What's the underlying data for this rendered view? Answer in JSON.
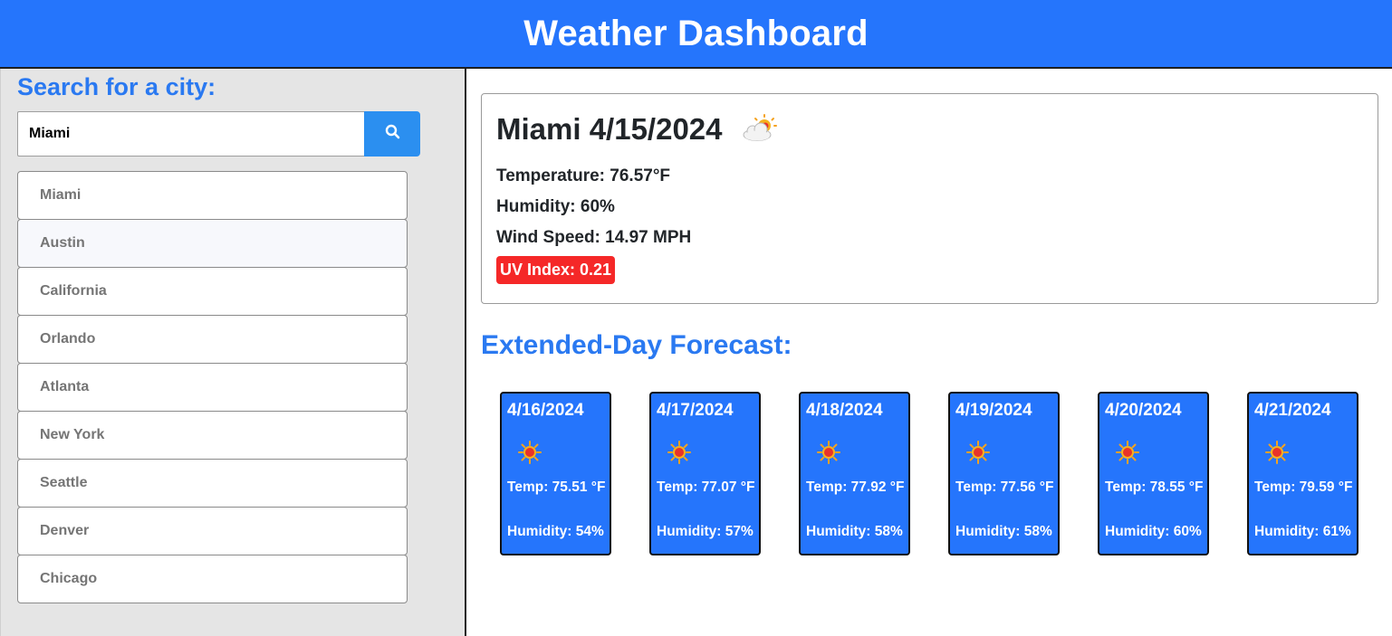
{
  "header": {
    "title": "Weather Dashboard"
  },
  "sidebar": {
    "heading": "Search for a city:",
    "search": {
      "value": "Miami",
      "placeholder": ""
    },
    "search_button_icon": "search-icon",
    "history": [
      {
        "label": "Miami"
      },
      {
        "label": "Austin"
      },
      {
        "label": "California"
      },
      {
        "label": "Orlando"
      },
      {
        "label": "Atlanta"
      },
      {
        "label": "New York"
      },
      {
        "label": "Seattle"
      },
      {
        "label": "Denver"
      },
      {
        "label": "Chicago"
      }
    ]
  },
  "current": {
    "title": "Miami 4/15/2024",
    "icon": "partly-cloudy-icon",
    "temperature": "Temperature: 76.57°F",
    "humidity": "Humidity: 60%",
    "wind": "Wind Speed: 14.97 MPH",
    "uv": "UV Index: 0.21",
    "uv_color": "#f52828"
  },
  "forecast": {
    "heading": "Extended-Day Forecast:",
    "days": [
      {
        "date": "4/16/2024",
        "icon": "sun-icon",
        "temp": "Temp: 75.51 °F",
        "humidity": "Humidity: 54%"
      },
      {
        "date": "4/17/2024",
        "icon": "sun-icon",
        "temp": "Temp: 77.07 °F",
        "humidity": "Humidity: 57%"
      },
      {
        "date": "4/18/2024",
        "icon": "sun-icon",
        "temp": "Temp: 77.92 °F",
        "humidity": "Humidity: 58%"
      },
      {
        "date": "4/19/2024",
        "icon": "sun-icon",
        "temp": "Temp: 77.56 °F",
        "humidity": "Humidity: 58%"
      },
      {
        "date": "4/20/2024",
        "icon": "sun-icon",
        "temp": "Temp: 78.55 °F",
        "humidity": "Humidity: 60%"
      },
      {
        "date": "4/21/2024",
        "icon": "sun-icon",
        "temp": "Temp: 79.59 °F",
        "humidity": "Humidity: 61%"
      }
    ]
  },
  "colors": {
    "brand": "#2575fc",
    "heading": "#2a79f1",
    "button": "#2b8ff0"
  }
}
